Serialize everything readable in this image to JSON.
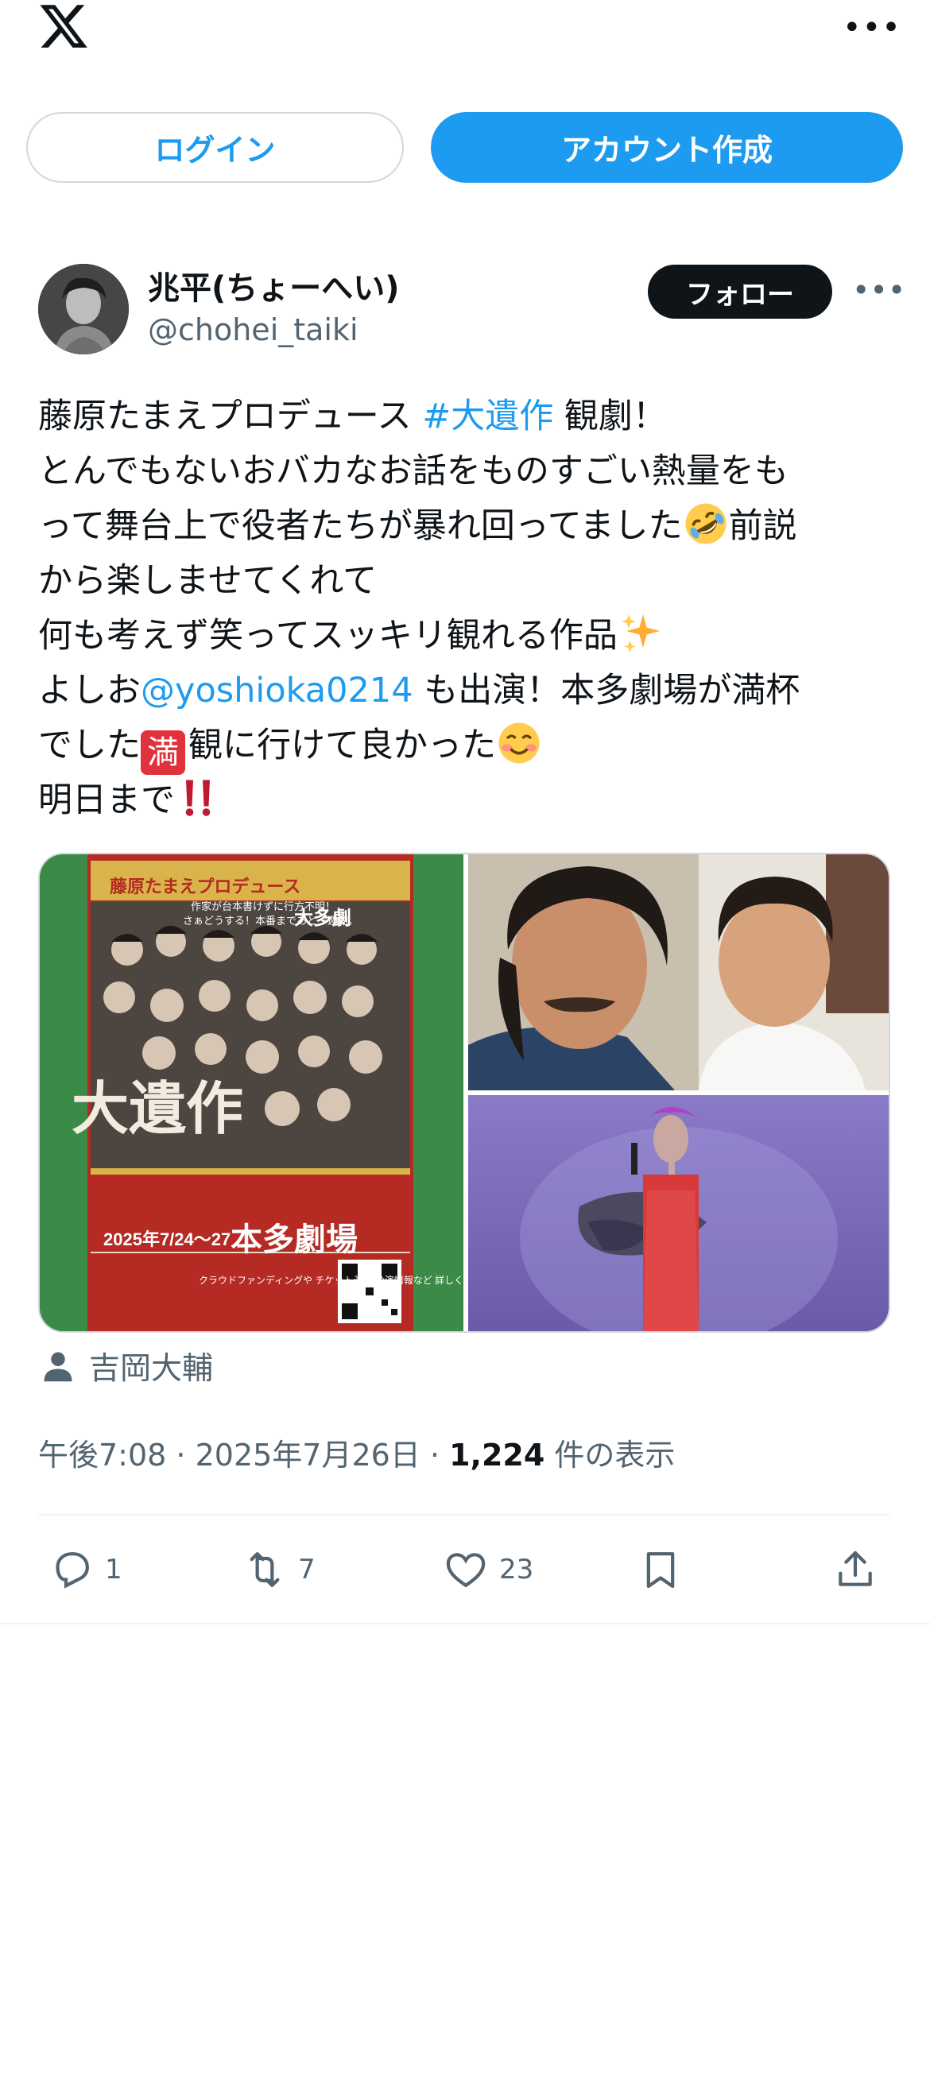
{
  "header": {
    "logo_icon": "x-logo-icon",
    "more_icon": "more-horizontal-icon",
    "more_label": "•••"
  },
  "auth": {
    "login_label": "ログイン",
    "signup_label": "アカウント作成"
  },
  "post": {
    "author": {
      "display_name": "兆平(ちょーへい)",
      "handle": "@chohei_taiki",
      "follow_label": "フォロー",
      "more_label": "•••"
    },
    "text_lines": [
      [
        "藤原たまえプロデュース ",
        "#大遺作",
        " 観劇！"
      ],
      [
        "とんでもないおバカなお話をものすごい熱量をも"
      ],
      [
        "って舞台上で役者たちが暴れ回ってました",
        "前説"
      ],
      [
        "から楽しませてくれて"
      ],
      [
        "何も考えず笑ってスッキリ観れる作品"
      ],
      [
        "よしお",
        "@yoshioka0214",
        " も出演！本多劇場が満杯"
      ],
      [
        "でした",
        "満",
        "観に行けて良かった"
      ],
      [
        "明日まで"
      ]
    ],
    "emojis": {
      "rofl": "rolling-on-floor-laughing-emoji",
      "sparkles": "sparkles-emoji",
      "blush": "smiling-face-emoji",
      "double_exclamation": "double-exclamation-emoji"
    },
    "media": {
      "poster_title": "大遺作",
      "poster_subtitle": "藤原たまえプロデュース",
      "poster_tagline": "作家が台本書けずに行方不明！",
      "poster_tagline2": "さぁどうする！本番まであと一週間。",
      "poster_dates": "2025年7/24〜27",
      "poster_venue": "本多劇場",
      "poster_top_label": "大多劇",
      "poster_side_note": "クラウドファンディングや\nチケット予約/公演情報など\n詳しくはこちらのサイトを\nご確認ください▶▶▶▶▶"
    },
    "tagged": {
      "icon": "person-icon",
      "name": "吉岡大輔"
    },
    "meta": {
      "time": "午後7:08",
      "date": "2025年7月26日",
      "separator": " · ",
      "views_count": "1,224",
      "views_label": " 件の表示"
    },
    "actions": {
      "reply_count": "1",
      "retweet_count": "7",
      "like_count": "23"
    }
  },
  "colors": {
    "accent": "#1d9bf0",
    "text_primary": "#0f1419",
    "text_secondary": "#536471",
    "border": "#cfd9de",
    "badge_red": "#e0313c"
  }
}
